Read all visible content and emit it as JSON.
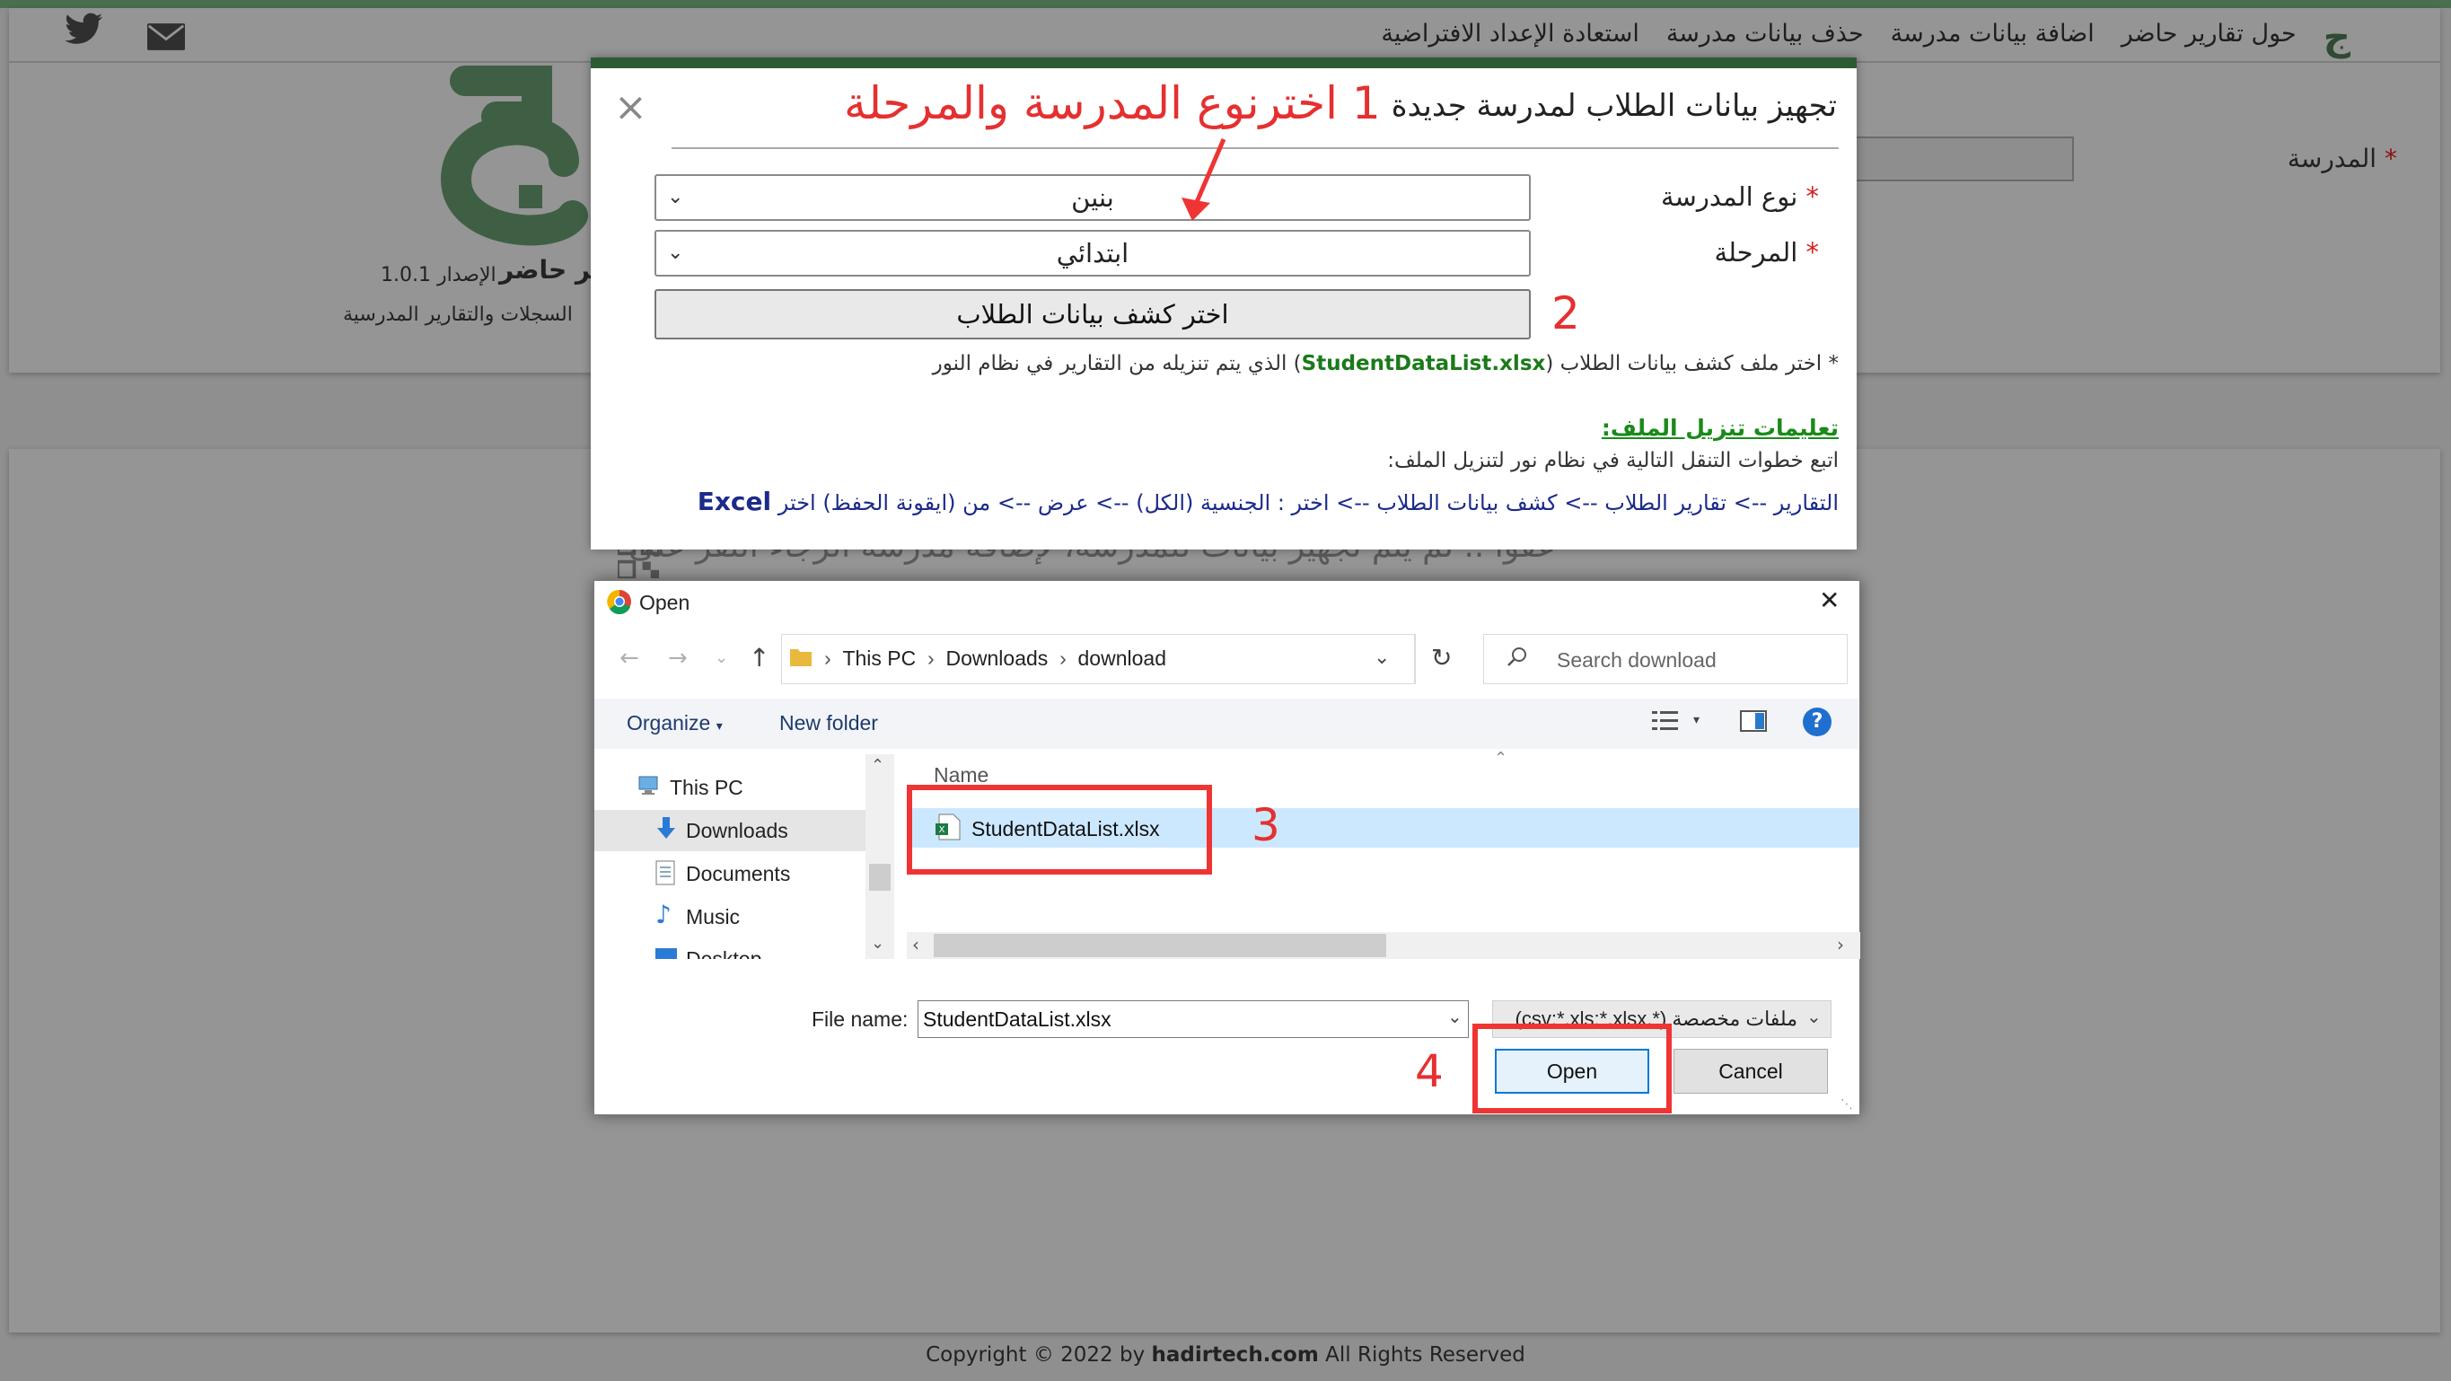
{
  "site": {
    "nav": [
      "حول تقارير حاضر",
      "اضافة بيانات مدرسة",
      "حذف بيانات مدرسة",
      "استعادة الإعداد الافتراضية"
    ],
    "app_name": "تقارير حاضر",
    "version_label": "الإصدار",
    "version": "1.0.1",
    "tagline": "السجلات والتقارير المدرسية",
    "school_label": "المدرسة",
    "sorry_text": "عفواً .. لم يتم تجهيز بيانات للمدرسة، لإضافة مدرسة الرجاء النقر على",
    "footer_prefix": "Copyright © 2022 by",
    "footer_site": "hadirtech.com",
    "footer_suffix": "All Rights Reserved",
    "accent": "#2d5a33"
  },
  "modal": {
    "title": "تجهيز بيانات الطلاب لمدرسة جديدة",
    "close": "×",
    "school_type_label": "نوع المدرسة",
    "school_type_value": "بنين",
    "stage_label": "المرحلة",
    "stage_value": "ابتدائي",
    "required_mark": "*",
    "pick_button": "اختر كشف بيانات الطلاب",
    "hint_prefix": "* اختر ملف كشف بيانات الطلاب (",
    "hint_file": "StudentDataList.xlsx",
    "hint_suffix": ") الذي يتم تنزيله من التقارير في نظام النور",
    "instructions_title": "تعليمات تنزيل الملف:",
    "instructions_line1": "اتبع خطوات التنقل التالية في نظام نور لتنزيل الملف:",
    "instructions_line2": "التقارير --> تقارير الطلاب --> كشف بيانات الطلاب --> اختر : الجنسية (الكل) --> عرض --> من (ايقونة الحفظ) اختر",
    "instructions_excel": "Excel"
  },
  "annotations": {
    "step1": "1  اخترنوع المدرسة والمرحلة",
    "step2": "2",
    "step3": "3",
    "step4": "4",
    "color": "#ef3434"
  },
  "dialog": {
    "title": "Open",
    "close": "✕",
    "breadcrumb": [
      "This PC",
      "Downloads",
      "download"
    ],
    "search_placeholder": "Search download",
    "organize": "Organize",
    "new_folder": "New folder",
    "nav_items": [
      "This PC",
      "Downloads",
      "Documents",
      "Music",
      "Desktop"
    ],
    "column_name": "Name",
    "file": "StudentDataList.xlsx",
    "file_name_label": "File name:",
    "file_name_value": "StudentDataList.xlsx",
    "file_type": "ملفات مخصصة (*.csv;*.xls;*.xlsx)",
    "open_button": "Open",
    "cancel_button": "Cancel"
  }
}
